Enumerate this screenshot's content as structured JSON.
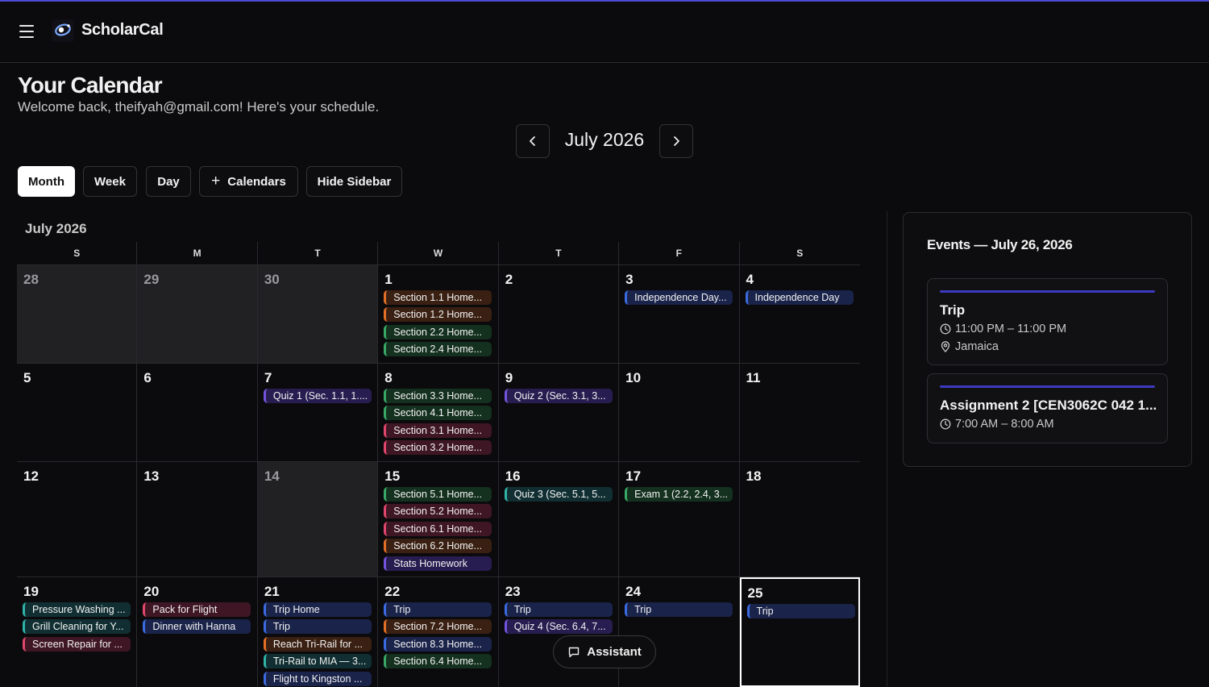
{
  "app": {
    "name": "ScholarCal"
  },
  "page": {
    "title": "Your Calendar",
    "subtitle": "Welcome back, theifyah@gmail.com! Here's your schedule."
  },
  "nav": {
    "current_month": "July 2026",
    "prev_icon": "chevron-left-icon",
    "next_icon": "chevron-right-icon"
  },
  "views": {
    "month": "Month",
    "week": "Week",
    "day": "Day",
    "calendars": "Calendars",
    "hide_sidebar": "Hide Sidebar",
    "active": "Month"
  },
  "calendar": {
    "label": "July 2026",
    "weekdays": [
      "S",
      "M",
      "T",
      "W",
      "T",
      "F",
      "S"
    ],
    "colors": {
      "orange": "#e46f26",
      "green": "#38a866",
      "blue": "#3b6be0",
      "purple": "#7554e0",
      "pink": "#e0476b",
      "teal": "#2fb3a8"
    },
    "weeks": [
      [
        {
          "day": "28",
          "muted": true,
          "events": []
        },
        {
          "day": "29",
          "muted": true,
          "events": []
        },
        {
          "day": "30",
          "muted": true,
          "events": []
        },
        {
          "day": "1",
          "events": [
            {
              "text": "Section 1.1 Home...",
              "color": "orange"
            },
            {
              "text": "Section 1.2 Home...",
              "color": "orange"
            },
            {
              "text": "Section 2.2 Home...",
              "color": "green"
            },
            {
              "text": "Section 2.4 Home...",
              "color": "green"
            }
          ]
        },
        {
          "day": "2",
          "events": []
        },
        {
          "day": "3",
          "events": [
            {
              "text": "Independence Day...",
              "color": "blue"
            }
          ]
        },
        {
          "day": "4",
          "events": [
            {
              "text": "Independence Day",
              "color": "blue"
            }
          ]
        }
      ],
      [
        {
          "day": "5",
          "events": []
        },
        {
          "day": "6",
          "events": []
        },
        {
          "day": "7",
          "events": [
            {
              "text": "Quiz 1 (Sec. 1.1, 1....",
              "color": "purple"
            }
          ]
        },
        {
          "day": "8",
          "events": [
            {
              "text": "Section 3.3 Home...",
              "color": "green"
            },
            {
              "text": "Section 4.1 Home...",
              "color": "green"
            },
            {
              "text": "Section 3.1 Home...",
              "color": "pink"
            },
            {
              "text": "Section 3.2 Home...",
              "color": "pink"
            }
          ]
        },
        {
          "day": "9",
          "events": [
            {
              "text": "Quiz 2 (Sec. 3.1, 3...",
              "color": "purple"
            }
          ]
        },
        {
          "day": "10",
          "events": []
        },
        {
          "day": "11",
          "events": []
        }
      ],
      [
        {
          "day": "12",
          "events": []
        },
        {
          "day": "13",
          "events": []
        },
        {
          "day": "14",
          "muted": true,
          "events": []
        },
        {
          "day": "15",
          "events": [
            {
              "text": "Section 5.1 Home...",
              "color": "green"
            },
            {
              "text": "Section 5.2 Home...",
              "color": "pink"
            },
            {
              "text": "Section 6.1 Home...",
              "color": "pink"
            },
            {
              "text": "Section 6.2 Home...",
              "color": "orange"
            },
            {
              "text": "Stats Homework",
              "color": "purple"
            }
          ]
        },
        {
          "day": "16",
          "events": [
            {
              "text": "Quiz 3 (Sec. 5.1, 5...",
              "color": "teal"
            }
          ]
        },
        {
          "day": "17",
          "events": [
            {
              "text": "Exam 1 (2.2, 2.4, 3...",
              "color": "green"
            }
          ]
        },
        {
          "day": "18",
          "events": []
        }
      ],
      [
        {
          "day": "19",
          "events": [
            {
              "text": "Pressure Washing ...",
              "color": "teal"
            },
            {
              "text": "Grill Cleaning for Y...",
              "color": "teal"
            },
            {
              "text": "Screen Repair for ...",
              "color": "pink"
            }
          ]
        },
        {
          "day": "20",
          "events": [
            {
              "text": "Pack for Flight",
              "color": "pink"
            },
            {
              "text": "Dinner with Hanna",
              "color": "blue"
            }
          ]
        },
        {
          "day": "21",
          "events": [
            {
              "text": "Trip Home",
              "color": "blue"
            },
            {
              "text": "Trip",
              "color": "blue"
            },
            {
              "text": "Reach Tri-Rail for ...",
              "color": "orange"
            },
            {
              "text": "Tri-Rail to MIA — 3...",
              "color": "teal"
            },
            {
              "text": "Flight to Kingston ...",
              "color": "blue"
            }
          ]
        },
        {
          "day": "22",
          "events": [
            {
              "text": "Trip",
              "color": "blue"
            },
            {
              "text": "Section 7.2 Home...",
              "color": "orange"
            },
            {
              "text": "Section 8.3 Home...",
              "color": "blue"
            },
            {
              "text": "Section 6.4 Home...",
              "color": "green"
            }
          ]
        },
        {
          "day": "23",
          "events": [
            {
              "text": "Trip",
              "color": "blue"
            },
            {
              "text": "Quiz 4 (Sec. 6.4, 7...",
              "color": "purple"
            }
          ]
        },
        {
          "day": "24",
          "events": [
            {
              "text": "Trip",
              "color": "blue"
            }
          ]
        },
        {
          "day": "25",
          "today": true,
          "events": [
            {
              "text": "Trip",
              "color": "blue"
            }
          ]
        }
      ]
    ]
  },
  "sidebar": {
    "title": "Events — July 26, 2026",
    "events": [
      {
        "title": "Trip",
        "time": "11:00 PM – 11:00 PM",
        "location": "Jamaica",
        "accent": "#3c3abf"
      },
      {
        "title": "Assignment 2 [CEN3062C 042 1...",
        "time": "7:00 AM – 8:00 AM",
        "accent": "#3c3abf"
      }
    ]
  },
  "assistant": {
    "label": "Assistant",
    "icon": "chat-icon"
  }
}
